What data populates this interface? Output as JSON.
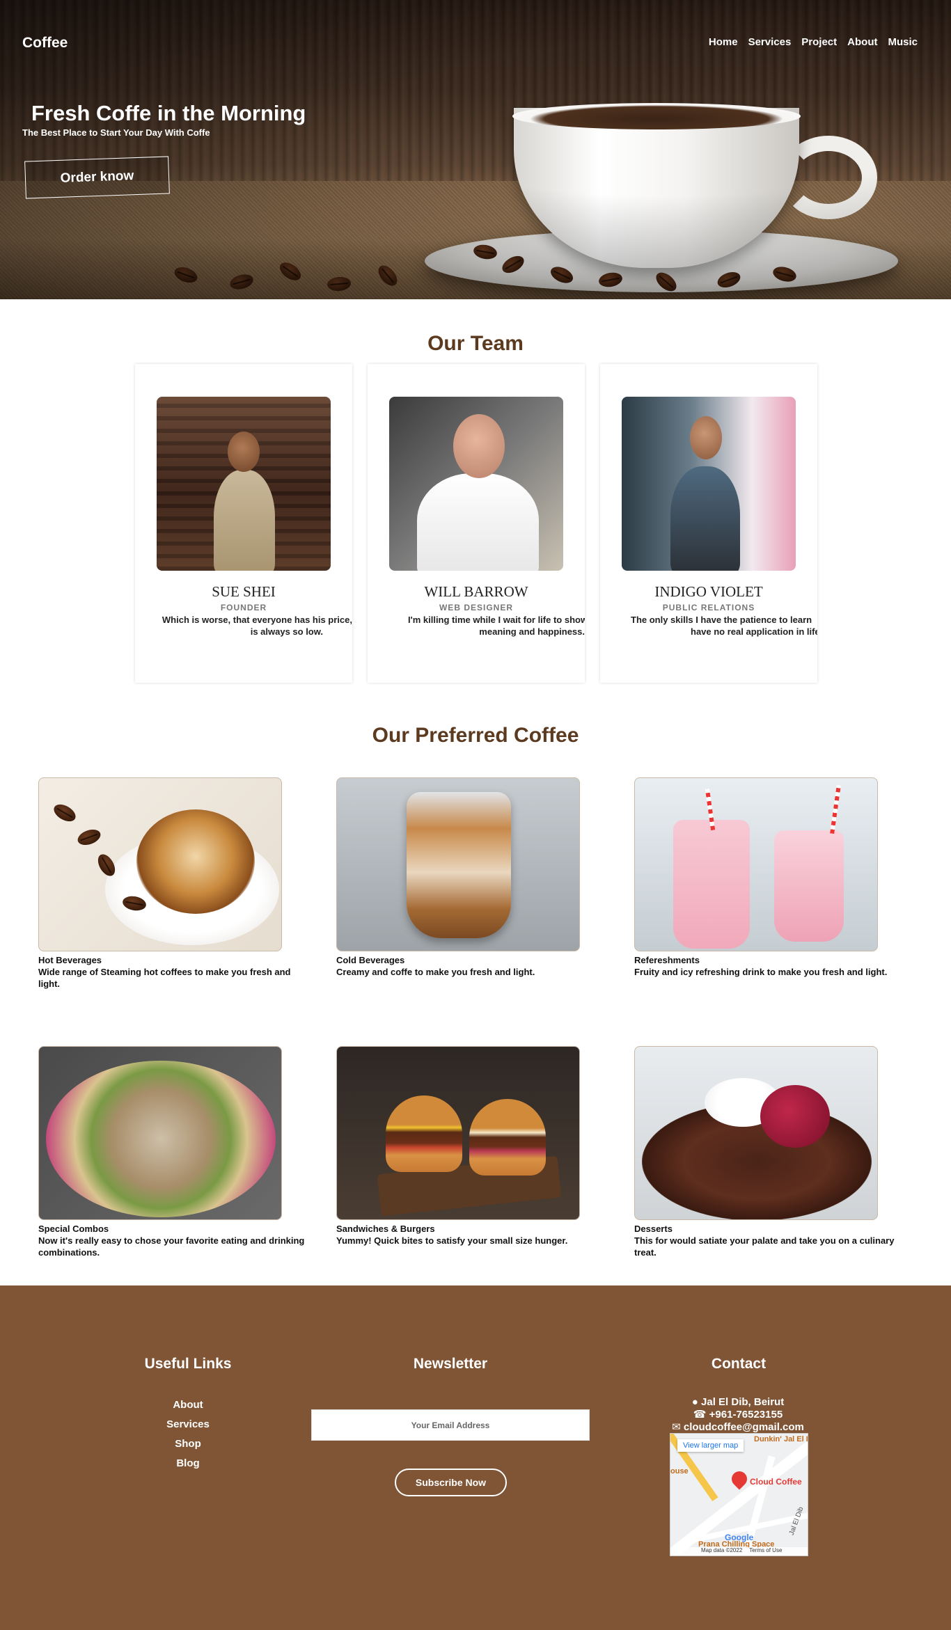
{
  "nav": {
    "logo": "Coffee",
    "links": [
      "Home",
      "Services",
      "Project",
      "About",
      "Music"
    ]
  },
  "hero": {
    "title": "Fresh Coffe in the Morning",
    "subtitle": "The Best Place to Start Your Day With Coffe",
    "button": "Order know"
  },
  "team": {
    "title": "Our Team",
    "members": [
      {
        "name": "SUE SHEI",
        "role": "FOUNDER",
        "quote_line1": "Which is worse, that everyone has his price,",
        "quote_line2": "is always so low."
      },
      {
        "name": "WILL BARROW",
        "role": "WEB DESIGNER",
        "quote_line1": "I'm killing time while I wait for life to shower",
        "quote_line2": "meaning and happiness."
      },
      {
        "name": "INDIGO VIOLET",
        "role": "PUBLIC RELATIONS",
        "quote_line1": "The only skills I have the patience to learn",
        "quote_line2": "have no real application in life."
      }
    ]
  },
  "coffee": {
    "title": "Our Preferred Coffee",
    "items": [
      {
        "title": "Hot Beverages",
        "desc": "Wide range of Steaming hot coffees to make you fresh and light."
      },
      {
        "title": "Cold Beverages",
        "desc": "Creamy and coffe to make you fresh and light."
      },
      {
        "title": "Refereshments",
        "desc": "Fruity and icy refreshing drink to make you fresh and light."
      },
      {
        "title": "Special Combos",
        "desc": "Now it's really easy to chose your favorite eating and drinking combinations."
      },
      {
        "title": "Sandwiches & Burgers",
        "desc": "Yummy! Quick bites to satisfy your small size hunger."
      },
      {
        "title": "Desserts",
        "desc": "This for would satiate your palate and take you on a culinary treat."
      }
    ]
  },
  "footer": {
    "links_title": "Useful Links",
    "links": [
      "About",
      "Services",
      "Shop",
      "Blog"
    ],
    "newsletter_title": "Newsletter",
    "email_placeholder": "Your Email Address",
    "subscribe": "Subscribe Now",
    "contact_title": "Contact",
    "address": "Jal El Dib, Beirut",
    "phone": "+961-76523155",
    "email": "cloudcoffee@gmail.com",
    "map": {
      "larger_map": "View larger map",
      "place": "Cloud Coffee",
      "street": "Jal El Dib",
      "poi_top": "Dunkin' Jal El Dib",
      "poi_left": "ouse",
      "poi_bottom": "Prana Chilling Space",
      "brand": "Google",
      "map_data": "Map data ©2022",
      "terms": "Terms of Use"
    }
  }
}
